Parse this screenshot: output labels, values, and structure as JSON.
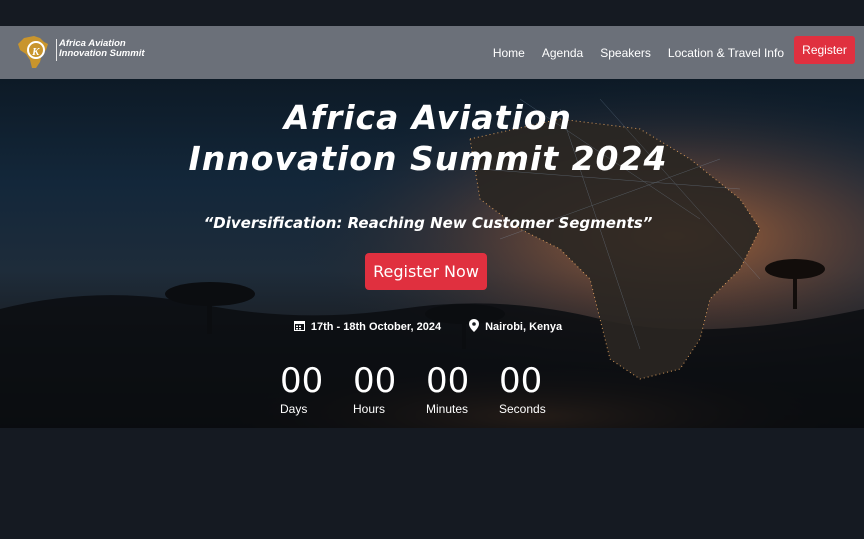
{
  "navbar": {
    "logo_line1": "Africa Aviation",
    "logo_line2": "Innovation Summit",
    "links": [
      "Home",
      "Agenda",
      "Speakers",
      "Location & Travel Info"
    ],
    "register_label": "Register"
  },
  "hero": {
    "title_line1": "Africa Aviation",
    "title_line2": "Innovation Summit 2024",
    "subtitle": "“Diversification: Reaching New Customer Segments”",
    "cta_label": "Register Now",
    "date": "17th - 18th October, 2024",
    "location": "Nairobi, Kenya"
  },
  "countdown": [
    {
      "value": "00",
      "label": "Days"
    },
    {
      "value": "00",
      "label": "Hours"
    },
    {
      "value": "00",
      "label": "Minutes"
    },
    {
      "value": "00",
      "label": "Seconds"
    }
  ],
  "colors": {
    "accent": "#e0303f",
    "navbar": "#6b7079",
    "page_bg": "#151a22"
  },
  "icons": [
    "calendar-icon",
    "map-pin-icon",
    "logo-africa-icon"
  ]
}
